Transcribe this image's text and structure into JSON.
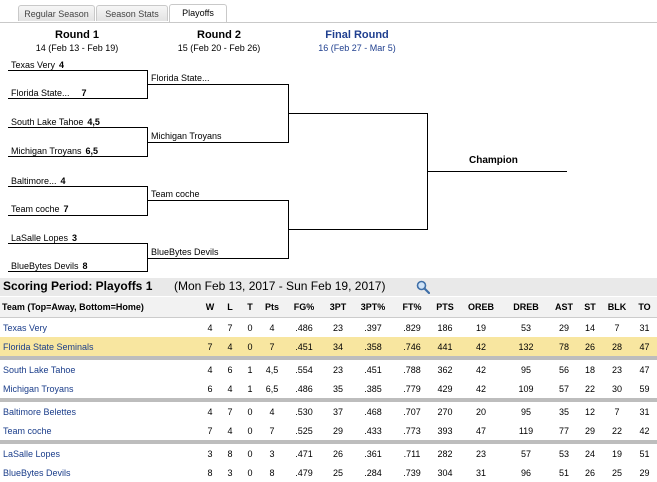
{
  "tabs": [
    {
      "label": "Regular Season"
    },
    {
      "label": "Season Stats"
    },
    {
      "label": "Playoffs"
    }
  ],
  "rounds": [
    {
      "title": "Round 1",
      "dates": "14 (Feb 13 - Feb 19)"
    },
    {
      "title": "Round 2",
      "dates": "15 (Feb 20 - Feb 26)"
    },
    {
      "title": "Final Round",
      "dates": "16 (Feb 27 - Mar 5)"
    }
  ],
  "round1": [
    {
      "name": "Texas Very",
      "score": "4"
    },
    {
      "name": "Florida State...",
      "score": "7"
    },
    {
      "name": "South Lake Tahoe",
      "score": "4,5"
    },
    {
      "name": "Michigan Troyans",
      "score": "6,5"
    },
    {
      "name": "Baltimore...",
      "score": "4"
    },
    {
      "name": "Team coche",
      "score": "7"
    },
    {
      "name": "LaSalle Lopes",
      "score": "3"
    },
    {
      "name": "BlueBytes Devils",
      "score": "8"
    }
  ],
  "round2": [
    {
      "name": "Florida State..."
    },
    {
      "name": "Michigan Troyans"
    },
    {
      "name": "Team coche"
    },
    {
      "name": "BlueBytes Devils"
    }
  ],
  "champion_label": "Champion",
  "scoring_period": {
    "title": "Scoring Period: Playoffs 1",
    "range": "(Mon Feb 13, 2017 - Sun Feb 19, 2017)",
    "icon": "magnifier-icon"
  },
  "stats": {
    "columns": [
      "Team (Top=Away, Bottom=Home)",
      "W",
      "L",
      "T",
      "Pts",
      "FG%",
      "3PT",
      "3PT%",
      "FT%",
      "PTS",
      "OREB",
      "DREB",
      "AST",
      "ST",
      "BLK",
      "TO"
    ],
    "rows": [
      [
        "Texas Very",
        "4",
        "7",
        "0",
        "4",
        ".486",
        "23",
        ".397",
        ".829",
        "186",
        "19",
        "53",
        "29",
        "14",
        "7",
        "31"
      ],
      [
        "Florida State Seminals",
        "7",
        "4",
        "0",
        "7",
        ".451",
        "34",
        ".358",
        ".746",
        "441",
        "42",
        "132",
        "78",
        "26",
        "28",
        "47"
      ],
      [
        "South Lake Tahoe",
        "4",
        "6",
        "1",
        "4,5",
        ".554",
        "23",
        ".451",
        ".788",
        "362",
        "42",
        "95",
        "56",
        "18",
        "23",
        "47"
      ],
      [
        "Michigan Troyans",
        "6",
        "4",
        "1",
        "6,5",
        ".486",
        "35",
        ".385",
        ".779",
        "429",
        "42",
        "109",
        "57",
        "22",
        "30",
        "59"
      ],
      [
        "Baltimore Belettes",
        "4",
        "7",
        "0",
        "4",
        ".530",
        "37",
        ".468",
        ".707",
        "270",
        "20",
        "95",
        "35",
        "12",
        "7",
        "31"
      ],
      [
        "Team coche",
        "7",
        "4",
        "0",
        "7",
        ".525",
        "29",
        ".433",
        ".773",
        "393",
        "47",
        "119",
        "77",
        "29",
        "22",
        "42"
      ],
      [
        "LaSalle Lopes",
        "3",
        "8",
        "0",
        "3",
        ".471",
        "26",
        ".361",
        ".711",
        "282",
        "23",
        "57",
        "53",
        "24",
        "19",
        "51"
      ],
      [
        "BlueBytes Devils",
        "8",
        "3",
        "0",
        "8",
        ".479",
        "25",
        ".284",
        ".739",
        "304",
        "31",
        "96",
        "51",
        "26",
        "25",
        "29"
      ]
    ]
  },
  "colors": {
    "highlight": "#f8e6a0",
    "link": "#1a3d8a",
    "final_round": "#1f3f8f",
    "separator": "#bdbdbd"
  }
}
